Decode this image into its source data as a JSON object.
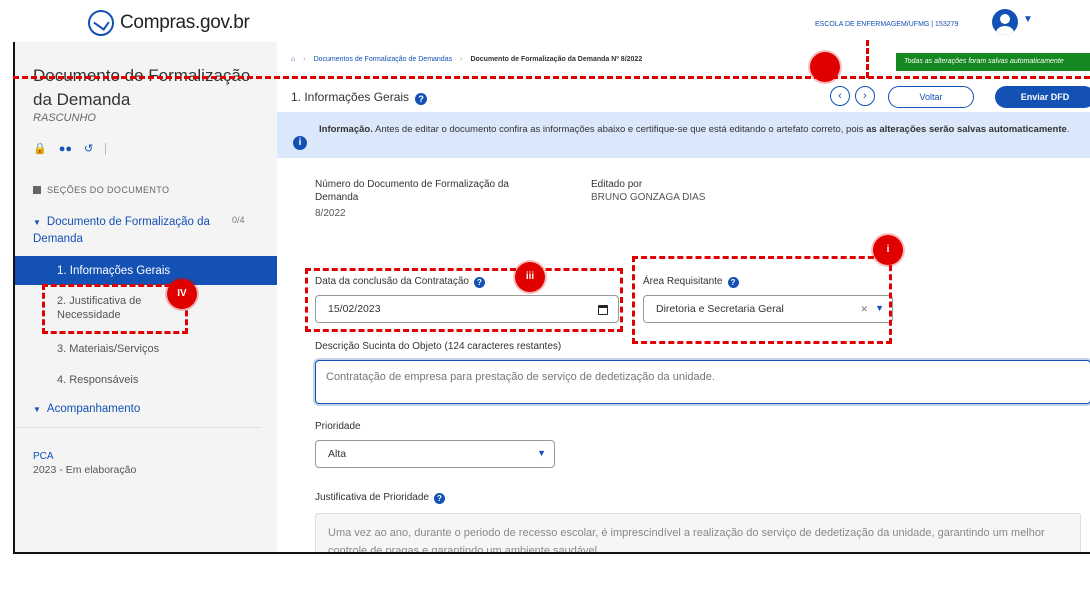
{
  "header": {
    "logo_text": "Compras.gov.br",
    "user_info": "ESCOLA DE ENFERMAGEM/UFMG | 153279"
  },
  "sidebar": {
    "doc_title": "Documento de Formalização da Demanda",
    "doc_status": "RASCUNHO",
    "section_header": "SEÇÕES DO DOCUMENTO",
    "group_label": "Documento de Formalização da Demanda",
    "group_count": "0/4",
    "items": [
      {
        "label": "1. Informações Gerais",
        "active": true
      },
      {
        "label": "2. Justificativa de Necessidade",
        "active": false
      },
      {
        "label": "3. Materiais/Serviços",
        "active": false
      },
      {
        "label": "4. Responsáveis",
        "active": false
      }
    ],
    "follow_label": "Acompanhamento",
    "pca_label": "PCA",
    "pca_value": "2023 - Em elaboração"
  },
  "breadcrumb": {
    "level1": "Documentos de Formalização de Demandas",
    "current": "Documento de Formalização da Demanda Nº 8/2022"
  },
  "saved_banner": "Todas as alterações foram salvas automaticamente",
  "section": {
    "title": "1. Informações Gerais",
    "voltar_label": "Voltar",
    "enviar_label": "Enviar DFD"
  },
  "info": {
    "bold_label": "Informação.",
    "text": "Antes de editar o documento confira as informações abaixo e certifique-se que está editando o artefato correto, pois",
    "bold_tail": "as alterações serão salvas automaticamente",
    "end": "."
  },
  "meta": {
    "number_label": "Número do Documento de Formalização da Demanda",
    "number_value": "8/2022",
    "editor_label": "Editado por",
    "editor_value": "BRUNO GONZAGA DIAS"
  },
  "form": {
    "date_label": "Data da conclusão da Contratação",
    "date_value": "15/02/2023",
    "area_label": "Área Requisitante",
    "area_value": "Diretoria e Secretaria Geral",
    "desc_label": "Descrição Sucinta do Objeto (124 caracteres restantes)",
    "desc_value": "Contratação de empresa para prestação de serviço de dedetização da unidade.",
    "priority_label": "Prioridade",
    "priority_value": "Alta",
    "just_label": "Justificativa de Prioridade",
    "just_value": "Uma vez ao ano, durante o periodo de recesso escolar, é imprescindível a realização do serviço de dedetização da unidade, garantindo um melhor controle de pragas e garantindo um ambiente saudável."
  },
  "annotations": {
    "marker_i": "i",
    "marker_iii": "iii",
    "marker_iv": "IV",
    "color": "#e00000"
  },
  "colors": {
    "primary": "#1351b4",
    "success": "#168821",
    "info_bg": "#dbe8fb",
    "sidebar_bg": "#f4f4f4"
  }
}
